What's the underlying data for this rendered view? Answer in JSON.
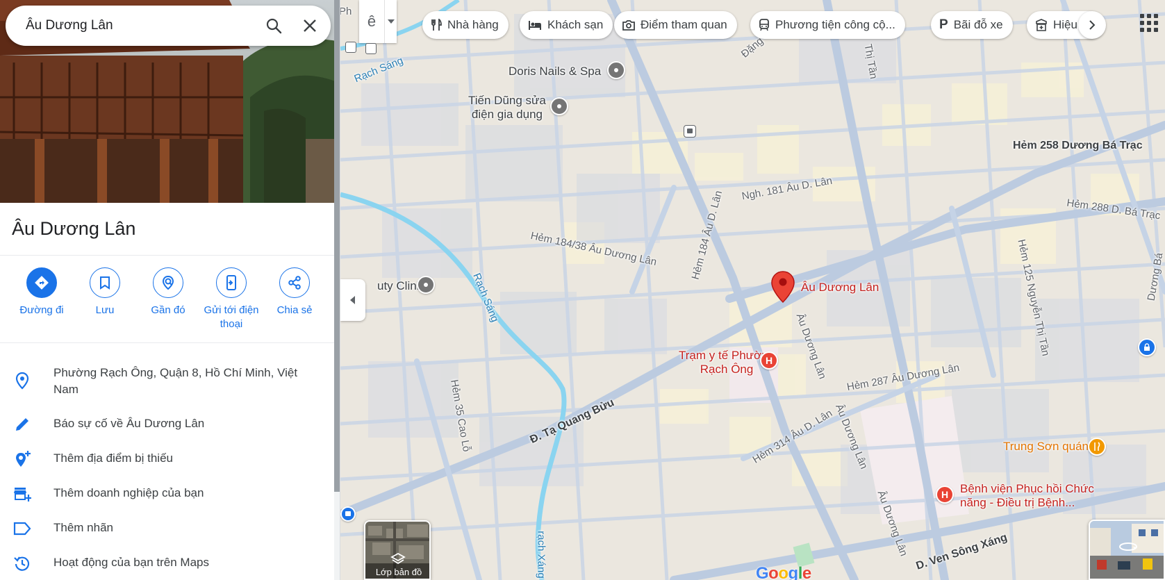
{
  "search": {
    "query": "Âu Dương Lân"
  },
  "place": {
    "title": "Âu Dương Lân"
  },
  "actions": [
    {
      "label": "Đường đi",
      "icon": "directions-icon"
    },
    {
      "label": "Lưu",
      "icon": "bookmark-icon"
    },
    {
      "label": "Gần đó",
      "icon": "nearby-icon"
    },
    {
      "label": "Gửi tới điện thoại",
      "icon": "send-to-phone-icon"
    },
    {
      "label": "Chia sẻ",
      "icon": "share-icon"
    }
  ],
  "info": {
    "address": "Phường Rạch Ông, Quận 8, Hồ Chí Minh, Việt Nam",
    "report": "Báo sự cố về Âu Dương Lân",
    "add_place": "Thêm địa điểm bị thiếu",
    "add_business": "Thêm doanh nghiệp của bạn",
    "add_label": "Thêm nhãn",
    "activity": "Hoạt động của bạn trên Maps"
  },
  "map": {
    "layer_toggle_glyph": "ê",
    "chips": [
      {
        "label": "Nhà hàng",
        "icon": "restaurant-icon"
      },
      {
        "label": "Khách sạn",
        "icon": "hotel-icon"
      },
      {
        "label": "Điểm tham quan",
        "icon": "camera-icon"
      },
      {
        "label": "Phương tiện công cộ...",
        "icon": "transit-icon"
      },
      {
        "label": "Bãi đỗ xe",
        "icon": "parking-icon"
      },
      {
        "label": "Hiệu",
        "icon": "pharmacy-icon"
      }
    ],
    "labels": {
      "rach_sang_1": "Rạch Sáng",
      "rach_sang_2": "Rạch Sáng",
      "rach_xang": "rạch Xáng",
      "doris": "Doris Nails & Spa",
      "tien_dung_1": "Tiến Dũng sửa",
      "tien_dung_2": "điện gia dụng",
      "beauty_clinic": "uty Clinic",
      "dang": "Đặng",
      "thi_tan": "Thị Tần",
      "hem_258": "Hẻm 258 Dương Bá Trạc",
      "hem_288": "Hẻm 288 D. Bá Trạc",
      "ngh_181": "Ngh. 181 Âu D. Lân",
      "hem_184_38": "Hẻm 184/38 Âu Dương Lân",
      "hem_184": "Hẻm 184 Âu D. Lân",
      "hem_125": "Hẻm 125 Nguyễn Thị Tần",
      "duong_ba": "Dương Bá",
      "pin_label": "Âu Dương Lân",
      "au_duong_lan_1": "Âu Dương Lân",
      "au_duong_lan_2": "Âu Dương Lân",
      "au_duong_lan_3": "Âu Dương Lân",
      "tram_y_te_1": "Trạm y tế Phường",
      "tram_y_te_2": "Rạch Ông",
      "hem_287": "Hẻm 287 Âu Dương Lân",
      "ta_quang_buu": "Đ. Tạ Quang Bửu",
      "hem_35": "Hẻm 35 Cao Lỗ",
      "hem_314": "Hẻm 314 Âu D. Lân",
      "trung_son": "Trung Sơn quán",
      "benh_vien_1": "Bệnh viện Phục hồi Chức",
      "benh_vien_2": "năng - Điều trị Bệnh...",
      "ven_song_xang": "D. Ven Sông Xáng",
      "buu": "ửu",
      "phu": "Ph"
    },
    "layers_label": "Lớp bản đồ",
    "hospital_glyph": "H",
    "colors": {
      "accent": "#1a73e8",
      "pin": "#ea4335",
      "water": "#8ad4f0",
      "road": "#c6d4e6",
      "land": "#e9e5dc"
    }
  }
}
